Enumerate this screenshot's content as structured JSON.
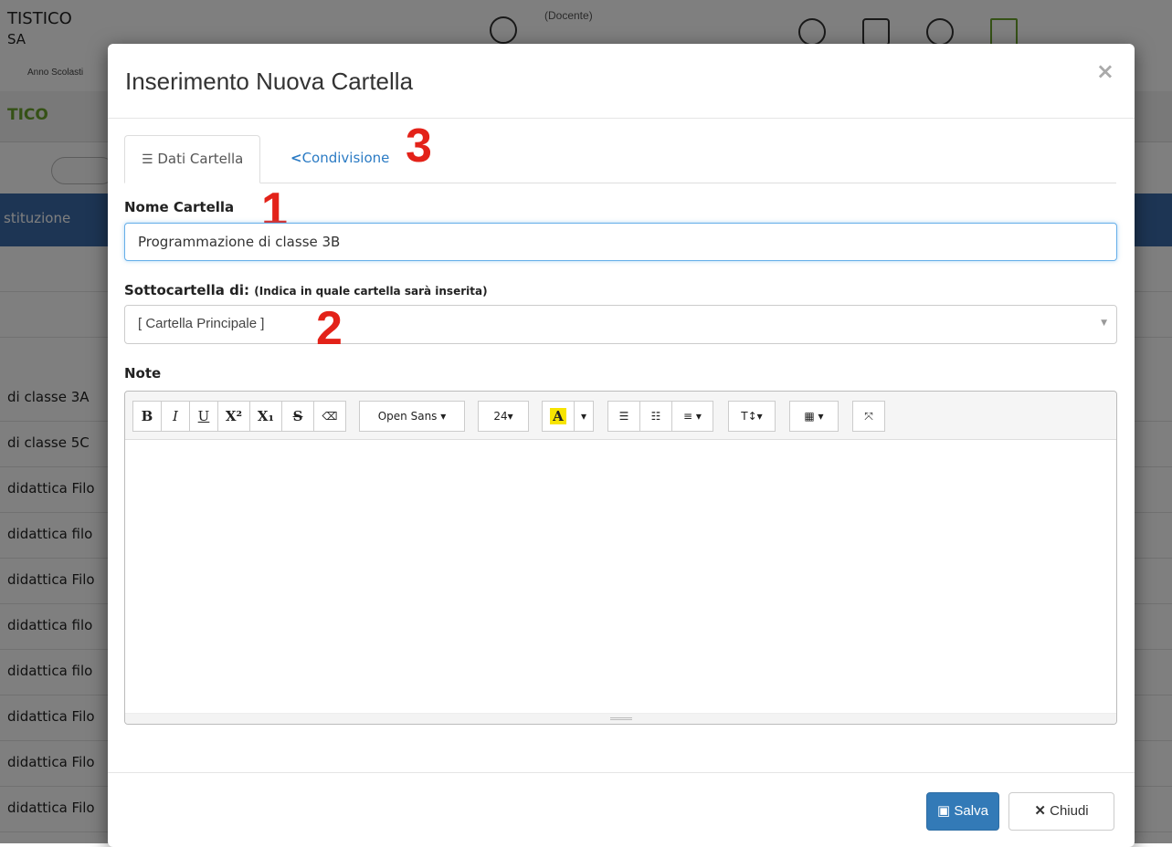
{
  "background": {
    "school_title": "TISTICO",
    "school_sub": "SA",
    "year_label": "Anno Scolasti",
    "role": "(Docente)",
    "section_title": "TICO",
    "column_header": "stituzione",
    "rows": [
      "di classe 3A",
      "di classe 5C",
      "didattica Filo",
      "didattica filo",
      "didattica Filo",
      "didattica filo",
      "didattica filo",
      "didattica Filo",
      "didattica Filo",
      "didattica Filo"
    ]
  },
  "modal": {
    "title": "Inserimento Nuova Cartella",
    "close_glyph": "×",
    "tabs": [
      {
        "label": "Dati Cartella",
        "icon": "align-left-icon",
        "active": true
      },
      {
        "label": "Condivisione",
        "icon": "share-icon",
        "active": false
      }
    ],
    "annotations": [
      "1",
      "2",
      "3"
    ],
    "fields": {
      "name_label": "Nome Cartella",
      "name_value": "Programmazione di classe 3B",
      "parent_label": "Sottocartella di:",
      "parent_hint": "(Indica in quale cartella sarà inserita)",
      "parent_value": "[ Cartella Principale ]",
      "note_label": "Note"
    },
    "toolbar": {
      "bold": "B",
      "italic": "I",
      "underline": "U",
      "superscript": "X²",
      "subscript": "X₁",
      "strikethrough": "S",
      "eraser": "⌫",
      "font_family": "Open Sans ▾",
      "font_size": "24▾",
      "color": "A",
      "color_caret": "▾",
      "ul": "☰",
      "ol": "☷",
      "align": "≡ ▾",
      "line_height": "T↕▾",
      "table": "▦ ▾",
      "fullscreen": "⤧"
    },
    "footer": {
      "save": "Salva",
      "close": "Chiudi"
    },
    "colors": {
      "accent": "#337ab7",
      "tab_link": "#2b7bc4",
      "annotation": "#e32219",
      "highlight": "#f7e400"
    }
  }
}
